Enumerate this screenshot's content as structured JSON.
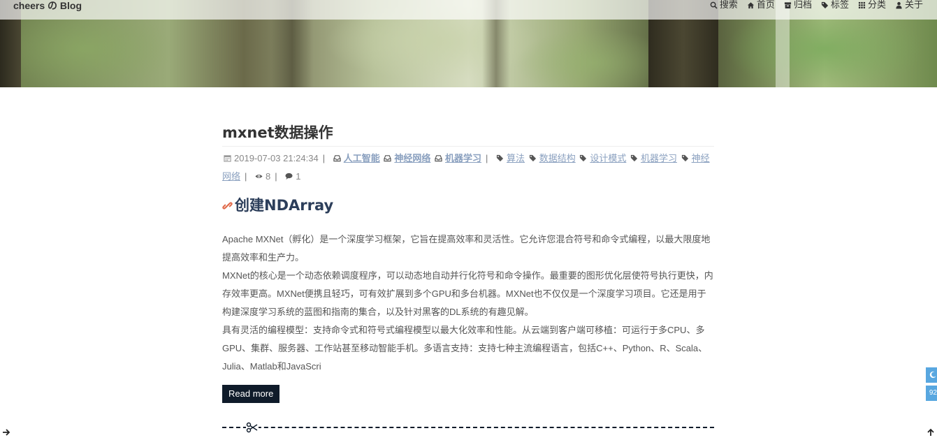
{
  "header": {
    "brand": "cheers の Blog",
    "nav": [
      {
        "label": "搜索",
        "icon": "search-icon"
      },
      {
        "label": "首页",
        "icon": "home-icon"
      },
      {
        "label": "归档",
        "icon": "archive-icon"
      },
      {
        "label": "标签",
        "icon": "tags-icon"
      },
      {
        "label": "分类",
        "icon": "grid-icon"
      },
      {
        "label": "关于",
        "icon": "user-icon"
      }
    ]
  },
  "post": {
    "title": "mxnet数据操作",
    "date": "2019-07-03 21:24:34",
    "categories": [
      "人工智能",
      "神经网络",
      "机器学习"
    ],
    "tags": [
      "算法",
      "数据结构",
      "设计模式",
      "机器学习",
      "神经网络"
    ],
    "views": "8",
    "comments": "1",
    "section_heading": "创建NDArray",
    "paragraphs": [
      "Apache MXNet（孵化）是一个深度学习框架，它旨在提高效率和灵活性。它允许您混合符号和命令式编程，以最大限度地提高效率和生产力。",
      "MXNet的核心是一个动态依赖调度程序，可以动态地自动并行化符号和命令操作。最重要的图形优化层使符号执行更快，内存效率更高。MXNet便携且轻巧，可有效扩展到多个GPU和多台机器。MXNet也不仅仅是一个深度学习项目。它还是用于构建深度学习系统的蓝图和指南的集合，以及针对黑客的DL系统的有趣见解。",
      "具有灵活的编程模型：支持命令式和符号式编程模型以最大化效率和性能。从云端到客户端可移植：可运行于多CPU、多GPU、集群、服务器、工作站甚至移动智能手机。多语言支持：支持七种主流编程语言，包括C++、Python、R、Scala、Julia、Matlab和JavaScri"
    ],
    "read_more": "Read more"
  },
  "side": {
    "counter": "92"
  },
  "colors": {
    "accent": "#58a7e0",
    "link": "#8aa0bf",
    "dark": "#0f1b2a"
  }
}
